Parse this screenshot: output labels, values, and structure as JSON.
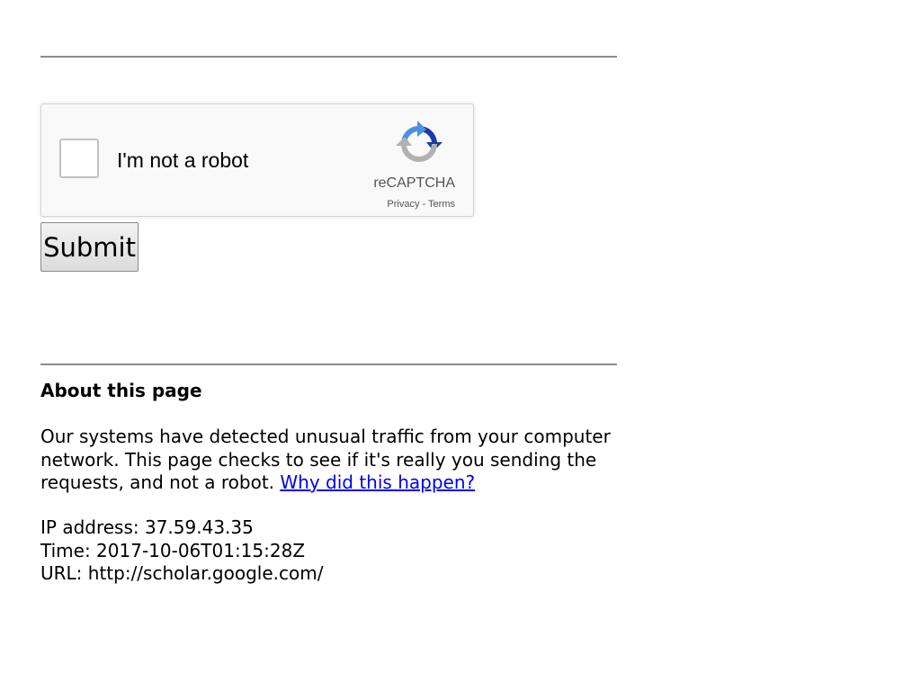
{
  "captcha": {
    "checkbox_label": "I'm not a robot",
    "brand": "reCAPTCHA",
    "privacy_link": "Privacy",
    "separator": " - ",
    "terms_link": "Terms",
    "logo_icon": "recaptcha-logo-icon",
    "colors": {
      "logo_blue": "#1c3aa9",
      "logo_light_blue": "#4a90e2",
      "logo_gray": "#b1b1b1"
    }
  },
  "form": {
    "submit_label": "Submit"
  },
  "about": {
    "title": "About this page",
    "paragraph": "Our systems have detected unusual traffic from your computer network. This page checks to see if it's really you sending the requests, and not a robot.",
    "link_text": "Why did this happen?",
    "link_color": "#0000ee"
  },
  "info": {
    "ip_line": "IP address: 37.59.43.35",
    "time_line": "Time: 2017-10-06T01:15:28Z",
    "url_line": "URL: http://scholar.google.com/"
  }
}
